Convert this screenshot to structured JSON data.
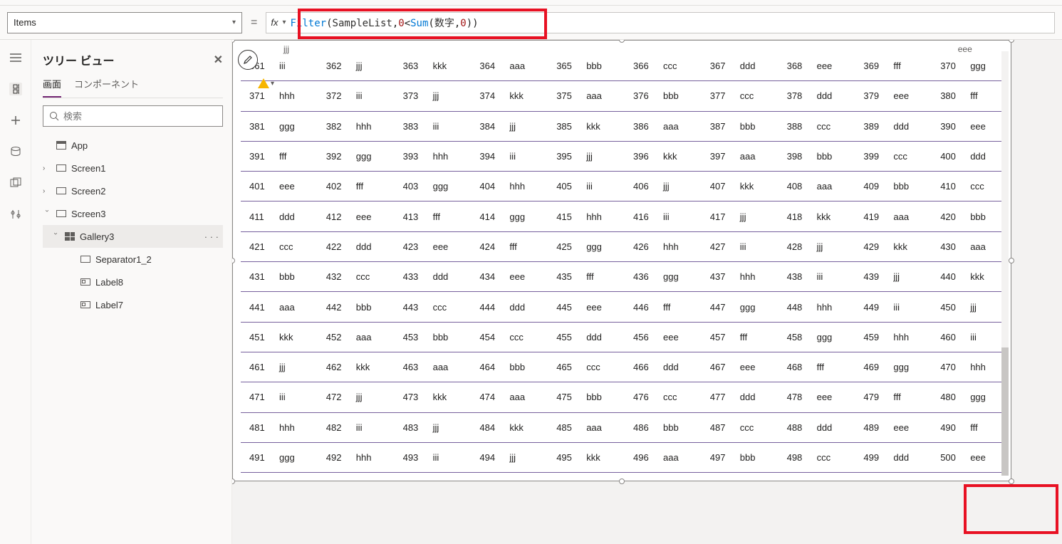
{
  "prop_selector": {
    "value": "Items"
  },
  "formula": {
    "fn1": "Filter",
    "open1": "(",
    "arg1": "SampleList",
    "comma1": ",",
    "num1": "0",
    "lt": "<",
    "fn2": "Sum",
    "open2": "(",
    "arg2": "数字",
    "comma2": ",",
    "num2": "0",
    "close2": ")",
    "close1": ")"
  },
  "tree": {
    "title": "ツリー ビュー",
    "tabs": {
      "screen": "画面",
      "component": "コンポーネント"
    },
    "search_placeholder": "検索",
    "app": "App",
    "screen1": "Screen1",
    "screen2": "Screen2",
    "screen3": "Screen3",
    "gallery": "Gallery3",
    "sep": "Separator1_2",
    "label8": "Label8",
    "label7": "Label7",
    "more": "· · ·"
  },
  "gallery": {
    "header_hint": "jjj",
    "header_hint2": "eee",
    "rows": [
      [
        {
          "n": 361,
          "v": "iii"
        },
        {
          "n": 362,
          "v": "jjj"
        },
        {
          "n": 363,
          "v": "kkk"
        },
        {
          "n": 364,
          "v": "aaa"
        },
        {
          "n": 365,
          "v": "bbb"
        },
        {
          "n": 366,
          "v": "ccc"
        },
        {
          "n": 367,
          "v": "ddd"
        },
        {
          "n": 368,
          "v": "eee"
        },
        {
          "n": 369,
          "v": "fff"
        },
        {
          "n": 370,
          "v": "ggg"
        }
      ],
      [
        {
          "n": 371,
          "v": "hhh"
        },
        {
          "n": 372,
          "v": "iii"
        },
        {
          "n": 373,
          "v": "jjj"
        },
        {
          "n": 374,
          "v": "kkk"
        },
        {
          "n": 375,
          "v": "aaa"
        },
        {
          "n": 376,
          "v": "bbb"
        },
        {
          "n": 377,
          "v": "ccc"
        },
        {
          "n": 378,
          "v": "ddd"
        },
        {
          "n": 379,
          "v": "eee"
        },
        {
          "n": 380,
          "v": "fff"
        }
      ],
      [
        {
          "n": 381,
          "v": "ggg"
        },
        {
          "n": 382,
          "v": "hhh"
        },
        {
          "n": 383,
          "v": "iii"
        },
        {
          "n": 384,
          "v": "jjj"
        },
        {
          "n": 385,
          "v": "kkk"
        },
        {
          "n": 386,
          "v": "aaa"
        },
        {
          "n": 387,
          "v": "bbb"
        },
        {
          "n": 388,
          "v": "ccc"
        },
        {
          "n": 389,
          "v": "ddd"
        },
        {
          "n": 390,
          "v": "eee"
        }
      ],
      [
        {
          "n": 391,
          "v": "fff"
        },
        {
          "n": 392,
          "v": "ggg"
        },
        {
          "n": 393,
          "v": "hhh"
        },
        {
          "n": 394,
          "v": "iii"
        },
        {
          "n": 395,
          "v": "jjj"
        },
        {
          "n": 396,
          "v": "kkk"
        },
        {
          "n": 397,
          "v": "aaa"
        },
        {
          "n": 398,
          "v": "bbb"
        },
        {
          "n": 399,
          "v": "ccc"
        },
        {
          "n": 400,
          "v": "ddd"
        }
      ],
      [
        {
          "n": 401,
          "v": "eee"
        },
        {
          "n": 402,
          "v": "fff"
        },
        {
          "n": 403,
          "v": "ggg"
        },
        {
          "n": 404,
          "v": "hhh"
        },
        {
          "n": 405,
          "v": "iii"
        },
        {
          "n": 406,
          "v": "jjj"
        },
        {
          "n": 407,
          "v": "kkk"
        },
        {
          "n": 408,
          "v": "aaa"
        },
        {
          "n": 409,
          "v": "bbb"
        },
        {
          "n": 410,
          "v": "ccc"
        }
      ],
      [
        {
          "n": 411,
          "v": "ddd"
        },
        {
          "n": 412,
          "v": "eee"
        },
        {
          "n": 413,
          "v": "fff"
        },
        {
          "n": 414,
          "v": "ggg"
        },
        {
          "n": 415,
          "v": "hhh"
        },
        {
          "n": 416,
          "v": "iii"
        },
        {
          "n": 417,
          "v": "jjj"
        },
        {
          "n": 418,
          "v": "kkk"
        },
        {
          "n": 419,
          "v": "aaa"
        },
        {
          "n": 420,
          "v": "bbb"
        }
      ],
      [
        {
          "n": 421,
          "v": "ccc"
        },
        {
          "n": 422,
          "v": "ddd"
        },
        {
          "n": 423,
          "v": "eee"
        },
        {
          "n": 424,
          "v": "fff"
        },
        {
          "n": 425,
          "v": "ggg"
        },
        {
          "n": 426,
          "v": "hhh"
        },
        {
          "n": 427,
          "v": "iii"
        },
        {
          "n": 428,
          "v": "jjj"
        },
        {
          "n": 429,
          "v": "kkk"
        },
        {
          "n": 430,
          "v": "aaa"
        }
      ],
      [
        {
          "n": 431,
          "v": "bbb"
        },
        {
          "n": 432,
          "v": "ccc"
        },
        {
          "n": 433,
          "v": "ddd"
        },
        {
          "n": 434,
          "v": "eee"
        },
        {
          "n": 435,
          "v": "fff"
        },
        {
          "n": 436,
          "v": "ggg"
        },
        {
          "n": 437,
          "v": "hhh"
        },
        {
          "n": 438,
          "v": "iii"
        },
        {
          "n": 439,
          "v": "jjj"
        },
        {
          "n": 440,
          "v": "kkk"
        }
      ],
      [
        {
          "n": 441,
          "v": "aaa"
        },
        {
          "n": 442,
          "v": "bbb"
        },
        {
          "n": 443,
          "v": "ccc"
        },
        {
          "n": 444,
          "v": "ddd"
        },
        {
          "n": 445,
          "v": "eee"
        },
        {
          "n": 446,
          "v": "fff"
        },
        {
          "n": 447,
          "v": "ggg"
        },
        {
          "n": 448,
          "v": "hhh"
        },
        {
          "n": 449,
          "v": "iii"
        },
        {
          "n": 450,
          "v": "jjj"
        }
      ],
      [
        {
          "n": 451,
          "v": "kkk"
        },
        {
          "n": 452,
          "v": "aaa"
        },
        {
          "n": 453,
          "v": "bbb"
        },
        {
          "n": 454,
          "v": "ccc"
        },
        {
          "n": 455,
          "v": "ddd"
        },
        {
          "n": 456,
          "v": "eee"
        },
        {
          "n": 457,
          "v": "fff"
        },
        {
          "n": 458,
          "v": "ggg"
        },
        {
          "n": 459,
          "v": "hhh"
        },
        {
          "n": 460,
          "v": "iii"
        }
      ],
      [
        {
          "n": 461,
          "v": "jjj"
        },
        {
          "n": 462,
          "v": "kkk"
        },
        {
          "n": 463,
          "v": "aaa"
        },
        {
          "n": 464,
          "v": "bbb"
        },
        {
          "n": 465,
          "v": "ccc"
        },
        {
          "n": 466,
          "v": "ddd"
        },
        {
          "n": 467,
          "v": "eee"
        },
        {
          "n": 468,
          "v": "fff"
        },
        {
          "n": 469,
          "v": "ggg"
        },
        {
          "n": 470,
          "v": "hhh"
        }
      ],
      [
        {
          "n": 471,
          "v": "iii"
        },
        {
          "n": 472,
          "v": "jjj"
        },
        {
          "n": 473,
          "v": "kkk"
        },
        {
          "n": 474,
          "v": "aaa"
        },
        {
          "n": 475,
          "v": "bbb"
        },
        {
          "n": 476,
          "v": "ccc"
        },
        {
          "n": 477,
          "v": "ddd"
        },
        {
          "n": 478,
          "v": "eee"
        },
        {
          "n": 479,
          "v": "fff"
        },
        {
          "n": 480,
          "v": "ggg"
        }
      ],
      [
        {
          "n": 481,
          "v": "hhh"
        },
        {
          "n": 482,
          "v": "iii"
        },
        {
          "n": 483,
          "v": "jjj"
        },
        {
          "n": 484,
          "v": "kkk"
        },
        {
          "n": 485,
          "v": "aaa"
        },
        {
          "n": 486,
          "v": "bbb"
        },
        {
          "n": 487,
          "v": "ccc"
        },
        {
          "n": 488,
          "v": "ddd"
        },
        {
          "n": 489,
          "v": "eee"
        },
        {
          "n": 490,
          "v": "fff"
        }
      ],
      [
        {
          "n": 491,
          "v": "ggg"
        },
        {
          "n": 492,
          "v": "hhh"
        },
        {
          "n": 493,
          "v": "iii"
        },
        {
          "n": 494,
          "v": "jjj"
        },
        {
          "n": 495,
          "v": "kkk"
        },
        {
          "n": 496,
          "v": "aaa"
        },
        {
          "n": 497,
          "v": "bbb"
        },
        {
          "n": 498,
          "v": "ccc"
        },
        {
          "n": 499,
          "v": "ddd"
        },
        {
          "n": 500,
          "v": "eee"
        }
      ]
    ]
  }
}
